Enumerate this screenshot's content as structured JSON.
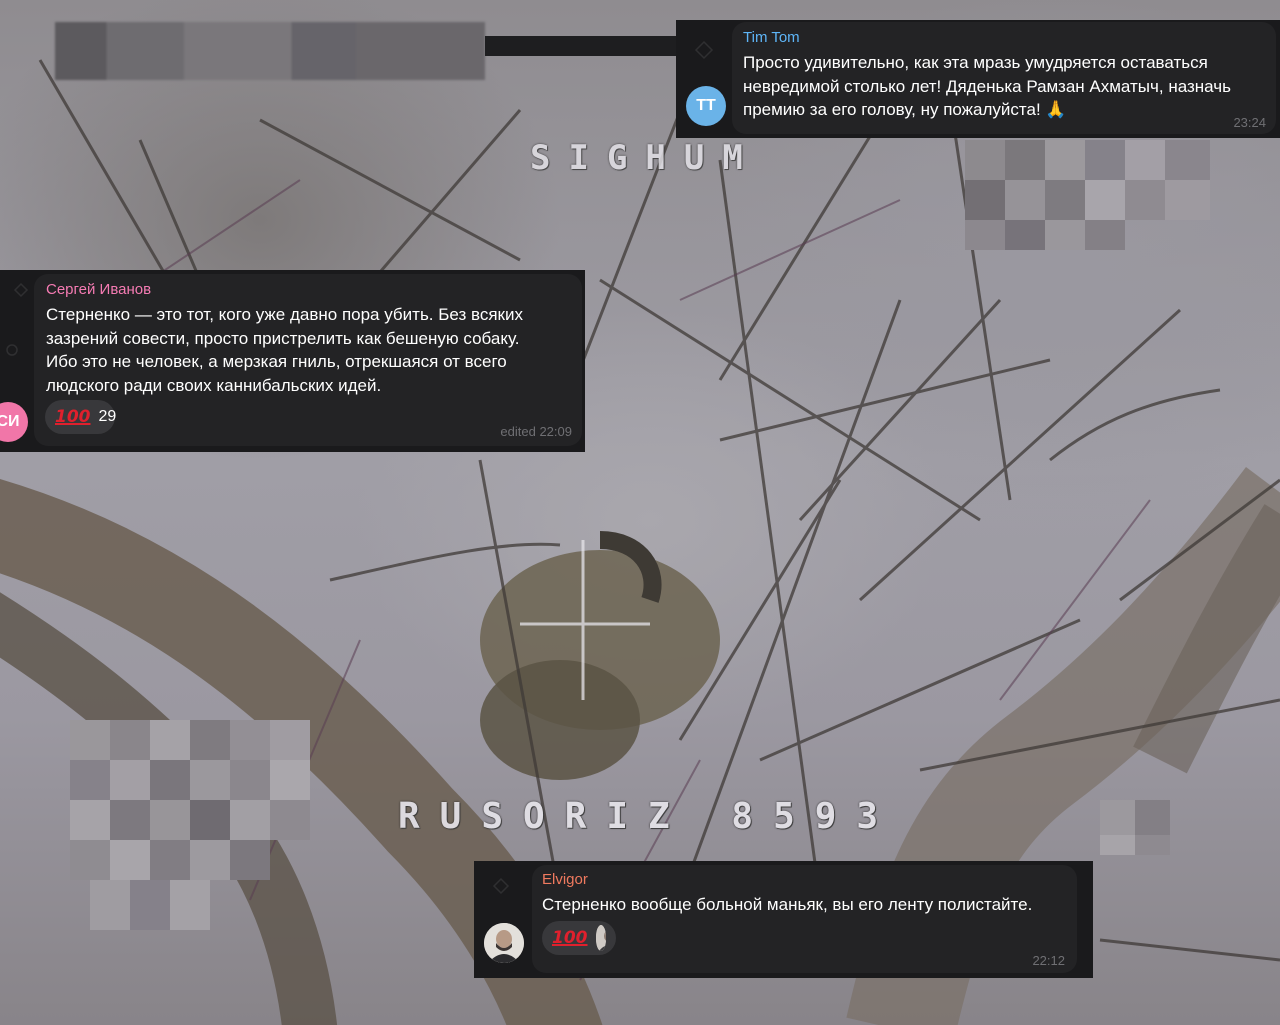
{
  "video": {
    "osd_top": "SIGHUM",
    "osd_bottom": "RUSORIZ 8593"
  },
  "messages": [
    {
      "sender": "Tim Tom",
      "sender_color": "#5eb5f7",
      "avatar_initials": "TT",
      "avatar_color": "#6ab3e8",
      "text": "Просто удивительно, как эта мразь умудряется оставаться\nневредимой столько лет! Дяденька Рамзан Ахматыч, назначь\nпремию за его голову, ну пожалуйста! 🙏",
      "time": "23:24"
    },
    {
      "sender": "Сергей Иванов",
      "sender_color": "#f57bb3",
      "avatar_initials": "СИ",
      "avatar_color": "#f176a8",
      "text": "Стерненко — это тот, кого уже давно пора убить. Без всяких\nзазрений совести, просто пристрелить как бешеную собаку.\nИбо это не человек, а мерзкая гниль, отрекшаяся от всего\nлюдского ради своих каннибальских идей.",
      "reaction_emoji": "100",
      "reaction_count": "29",
      "time": "edited 22:09"
    },
    {
      "sender": "Elvigor",
      "sender_color": "#f07a5f",
      "avatar_icon": "user-photo-icon",
      "text": "Стерненко вообще больной маньяк, вы его ленту полистайте.",
      "reaction_emoji": "100",
      "time": "22:12"
    }
  ]
}
